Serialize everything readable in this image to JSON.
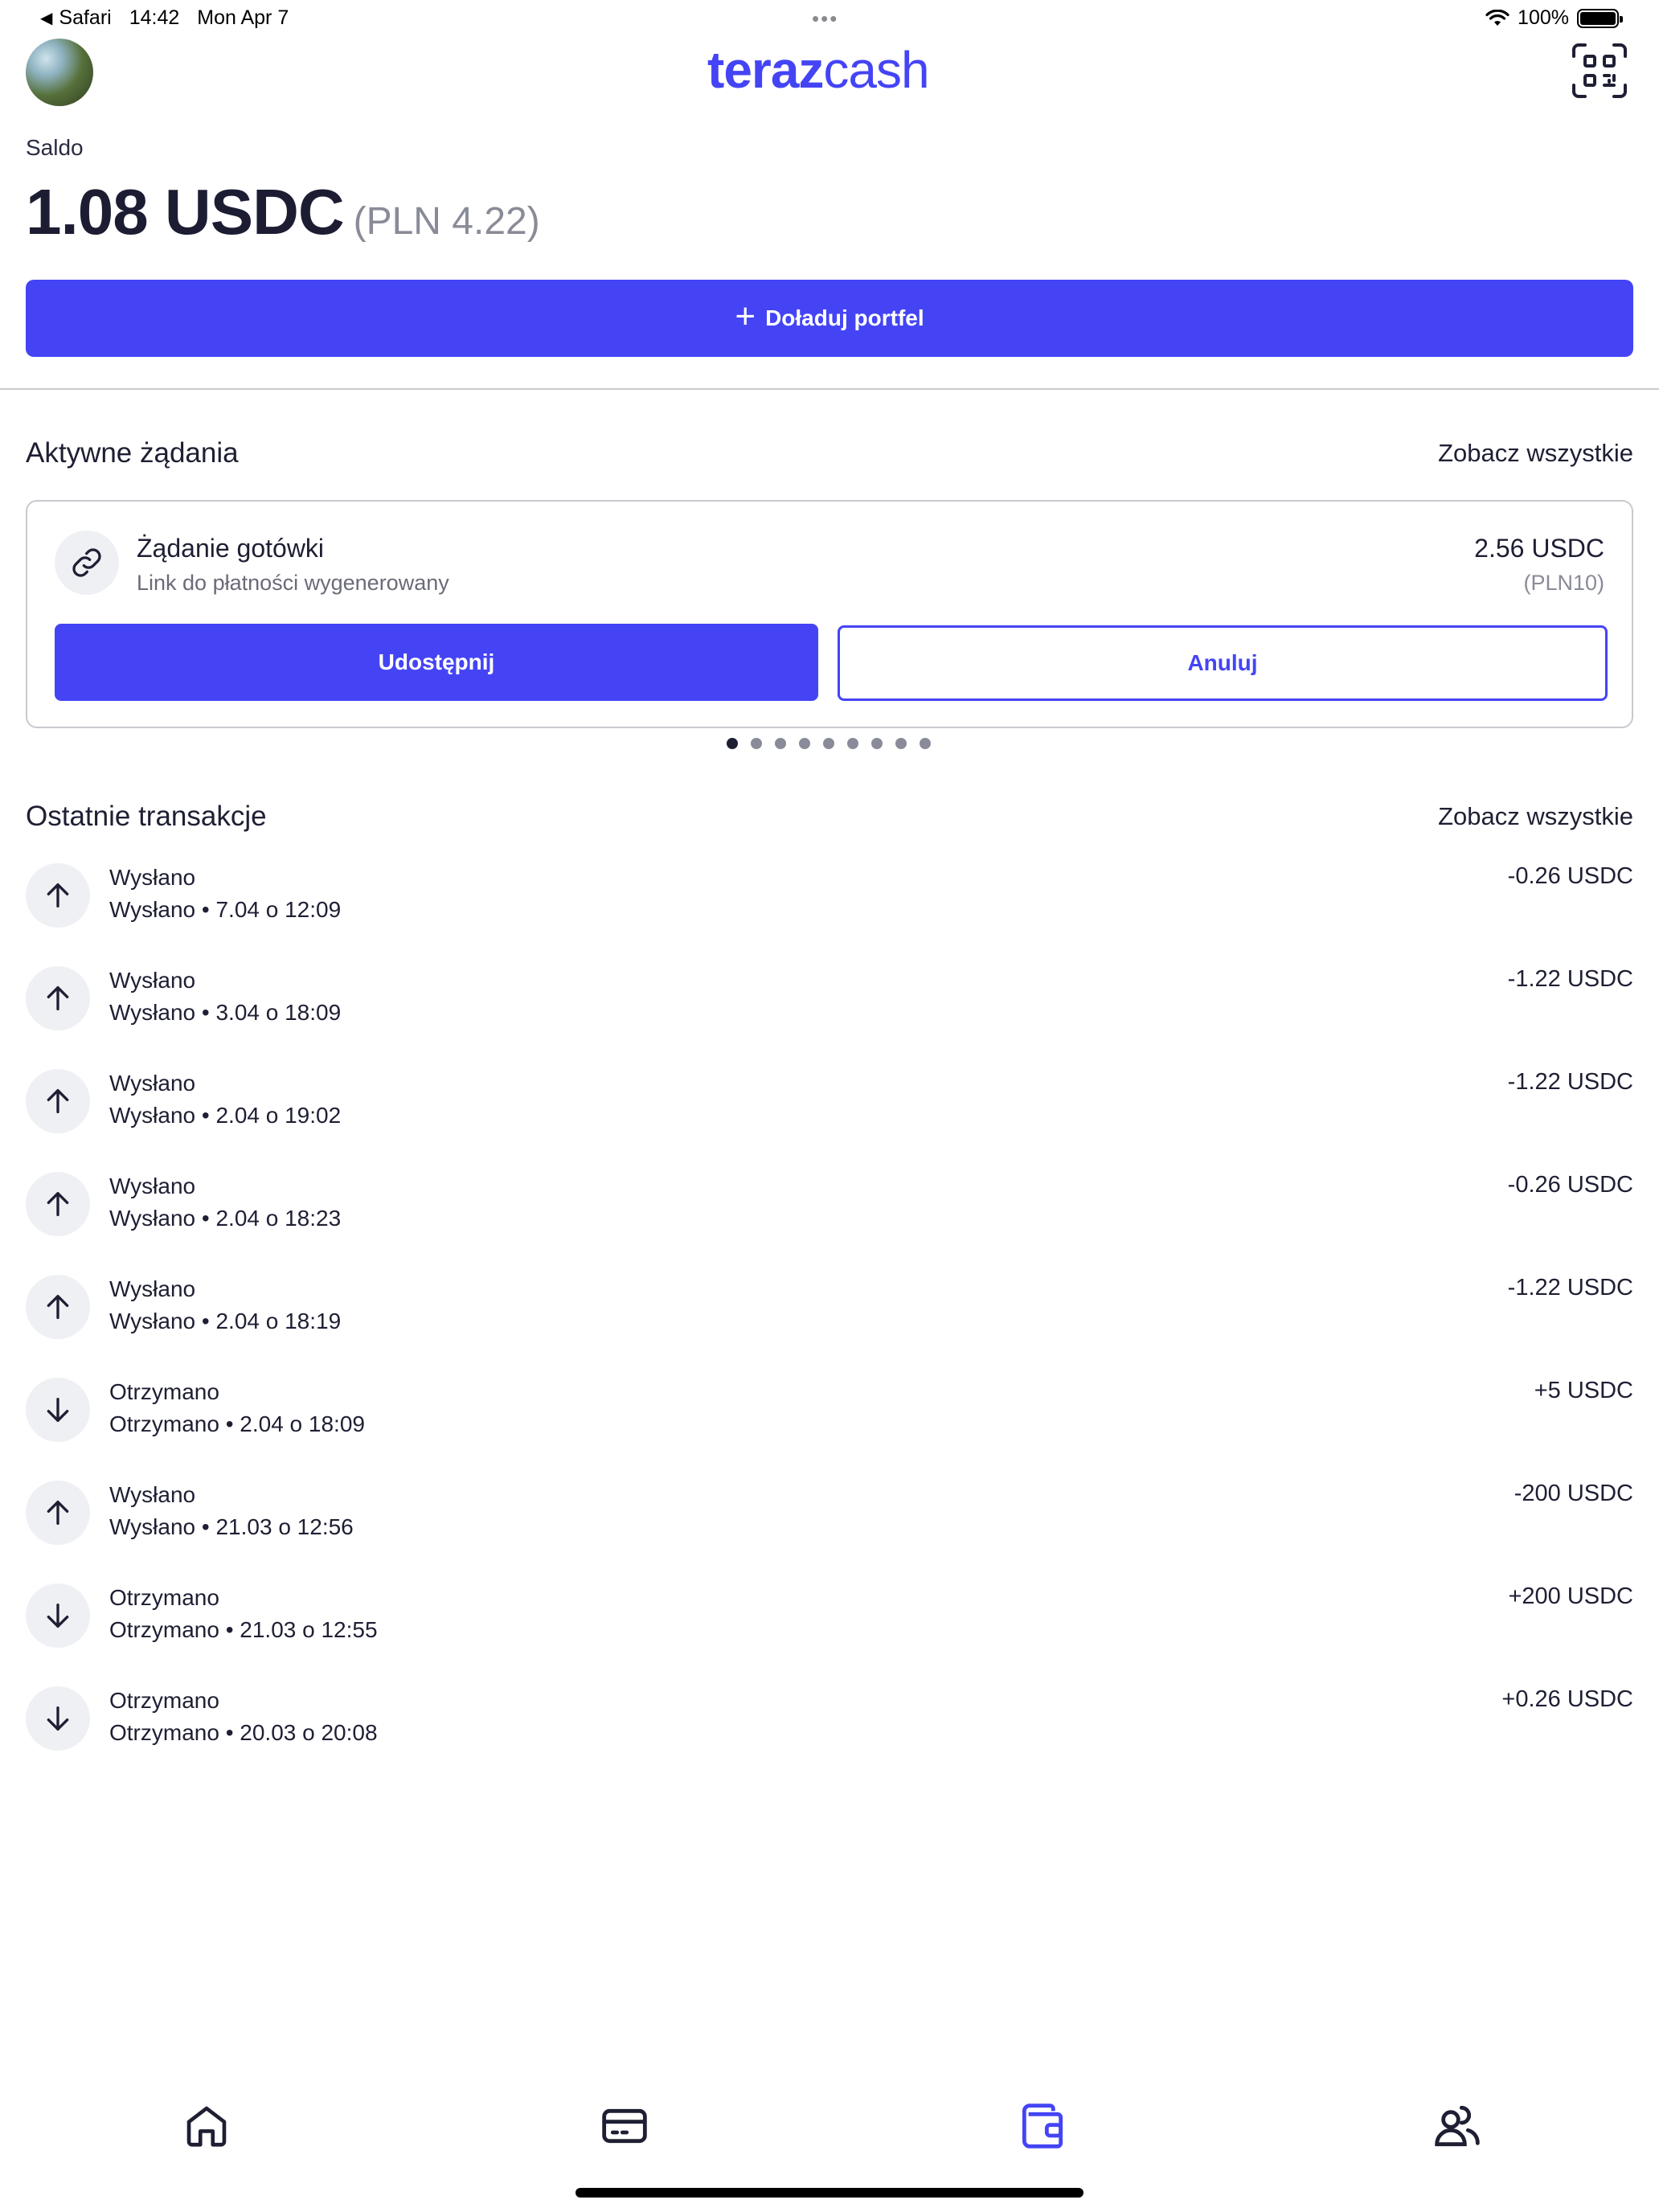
{
  "status_bar": {
    "back_app": "Safari",
    "time": "14:42",
    "date": "Mon Apr 7",
    "battery": "100%"
  },
  "header": {
    "logo_bold": "teraz",
    "logo_light": "cash",
    "qr_icon": "qr-scan-icon"
  },
  "balance": {
    "label": "Saldo",
    "amount": "1.08 USDC",
    "fiat": "(PLN 4.22)",
    "topup_label": "Doładuj portfel"
  },
  "active_requests": {
    "title": "Aktywne żądania",
    "see_all": "Zobacz wszystkie",
    "card": {
      "title": "Żądanie gotówki",
      "subtitle": "Link do płatności wygenerowany",
      "amount": "2.56 USDC",
      "fiat": "(PLN10)",
      "share_label": "Udostępnij",
      "cancel_label": "Anuluj"
    },
    "pager_count": 9,
    "pager_active": 0
  },
  "transactions": {
    "title": "Ostatnie transakcje",
    "see_all": "Zobacz wszystkie",
    "items": [
      {
        "type": "sent",
        "title": "Wysłano",
        "subtitle": "Wysłano • 7.04 o 12:09",
        "amount": "-0.26 USDC"
      },
      {
        "type": "sent",
        "title": "Wysłano",
        "subtitle": "Wysłano • 3.04 o 18:09",
        "amount": "-1.22 USDC"
      },
      {
        "type": "sent",
        "title": "Wysłano",
        "subtitle": "Wysłano • 2.04 o 19:02",
        "amount": "-1.22 USDC"
      },
      {
        "type": "sent",
        "title": "Wysłano",
        "subtitle": "Wysłano • 2.04 o 18:23",
        "amount": "-0.26 USDC"
      },
      {
        "type": "sent",
        "title": "Wysłano",
        "subtitle": "Wysłano • 2.04 o 18:19",
        "amount": "-1.22 USDC"
      },
      {
        "type": "received",
        "title": "Otrzymano",
        "subtitle": "Otrzymano • 2.04 o 18:09",
        "amount": "+5 USDC"
      },
      {
        "type": "sent",
        "title": "Wysłano",
        "subtitle": "Wysłano • 21.03 o 12:56",
        "amount": "-200 USDC"
      },
      {
        "type": "received",
        "title": "Otrzymano",
        "subtitle": "Otrzymano • 21.03 o 12:55",
        "amount": "+200 USDC"
      },
      {
        "type": "received",
        "title": "Otrzymano",
        "subtitle": "Otrzymano • 20.03 o 20:08",
        "amount": "+0.26 USDC"
      }
    ]
  },
  "bottom_nav": [
    {
      "icon": "home-icon",
      "active": false
    },
    {
      "icon": "card-icon",
      "active": false
    },
    {
      "icon": "wallet-icon",
      "active": true
    },
    {
      "icon": "contacts-icon",
      "active": false
    }
  ],
  "colors": {
    "accent": "#4444f5",
    "text": "#1e1f33",
    "muted": "#8a8b98",
    "icon_bg": "#eff0f4"
  }
}
